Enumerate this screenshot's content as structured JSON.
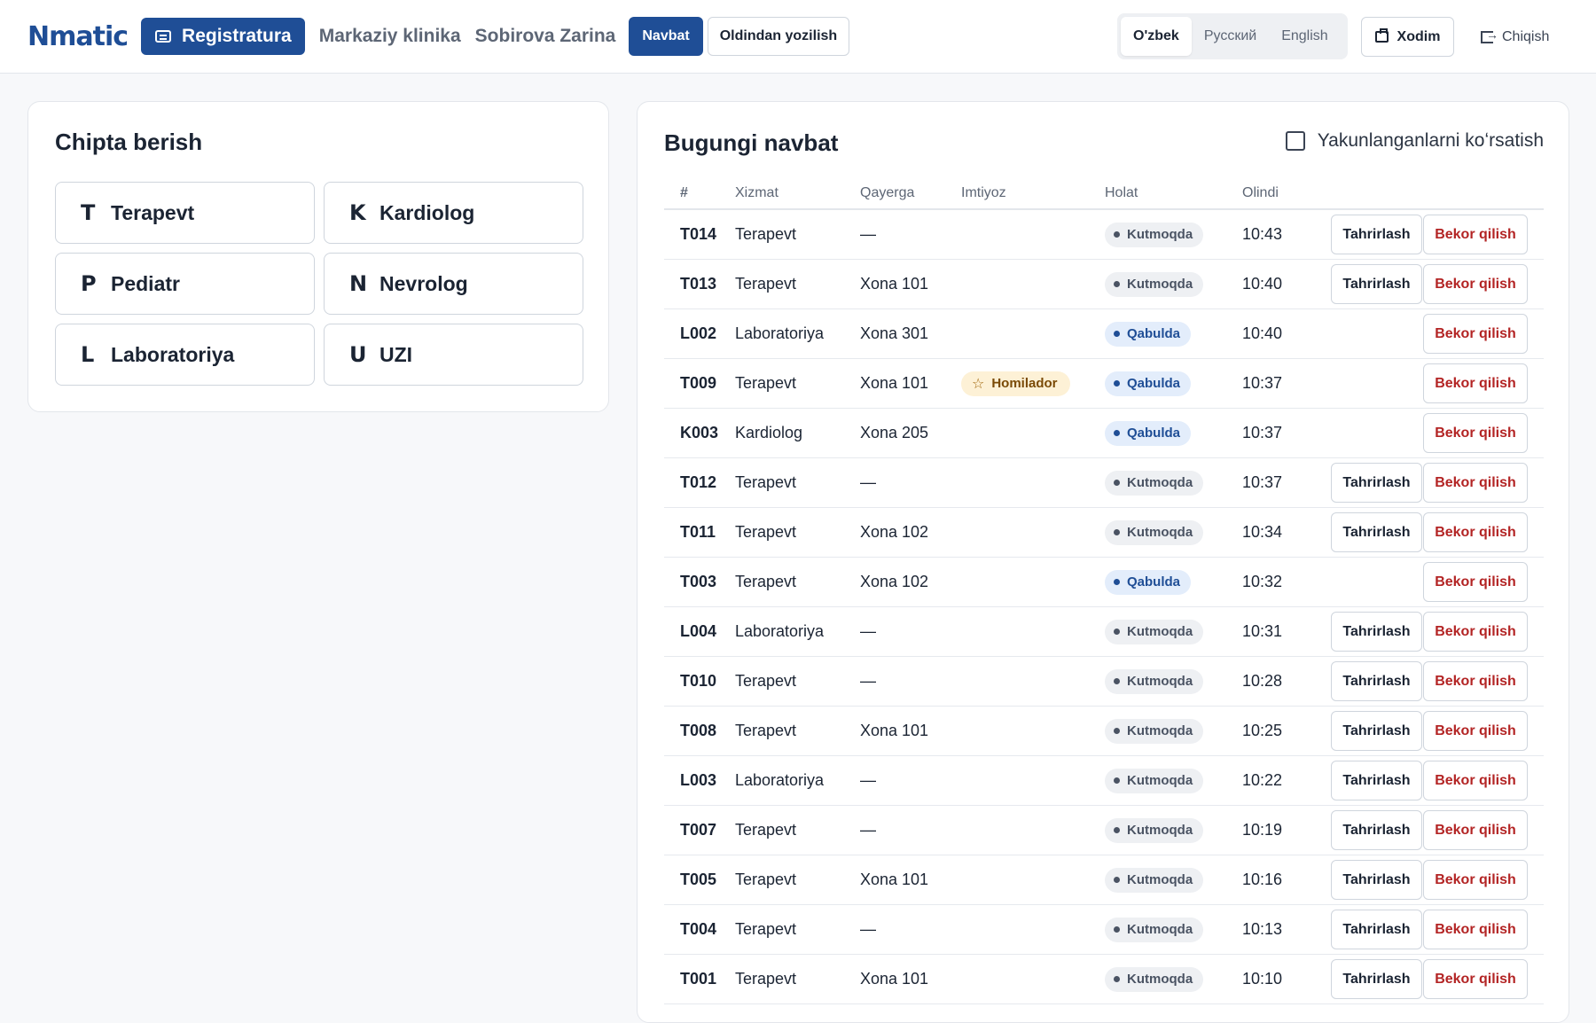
{
  "header": {
    "logo": "Nmatic",
    "registratura_label": "Registratura",
    "clinic_name": "Markaziy klinika",
    "user_name": "Sobirova Zarina",
    "navbat_label": "Navbat",
    "prebook_label": "Oldindan yozilish",
    "languages": [
      "O'zbek",
      "Русский",
      "English"
    ],
    "active_language": "O'zbek",
    "staff_label": "Xodim",
    "logout_label": "Chiqish"
  },
  "ticket_panel": {
    "title": "Chipta berish",
    "services": [
      {
        "letter": "T",
        "label": "Terapevt"
      },
      {
        "letter": "K",
        "label": "Kardiolog"
      },
      {
        "letter": "P",
        "label": "Pediatr"
      },
      {
        "letter": "N",
        "label": "Nevrolog"
      },
      {
        "letter": "L",
        "label": "Laboratoriya"
      },
      {
        "letter": "U",
        "label": "UZI"
      }
    ]
  },
  "queue": {
    "title": "Bugungi navbat",
    "show_completed_label": "Yakunlanganlarni koʻrsatish",
    "show_completed_checked": false,
    "columns": [
      "#",
      "Xizmat",
      "Qayerga",
      "Imtiyoz",
      "Holat",
      "Olindi"
    ],
    "edit_label": "Tahrirlash",
    "cancel_label": "Bekor qilish",
    "rows": [
      {
        "id": "T014",
        "service": "Terapevt",
        "room": "—",
        "privilege": "",
        "status": "Kutmoqda",
        "status_type": "wait",
        "time": "10:43",
        "editable": true
      },
      {
        "id": "T013",
        "service": "Terapevt",
        "room": "Xona 101",
        "privilege": "",
        "status": "Kutmoqda",
        "status_type": "wait",
        "time": "10:40",
        "editable": true
      },
      {
        "id": "L002",
        "service": "Laboratoriya",
        "room": "Xona 301",
        "privilege": "",
        "status": "Qabulda",
        "status_type": "inroom",
        "time": "10:40",
        "editable": false
      },
      {
        "id": "T009",
        "service": "Terapevt",
        "room": "Xona 101",
        "privilege": "Homilador",
        "status": "Qabulda",
        "status_type": "inroom",
        "time": "10:37",
        "editable": false
      },
      {
        "id": "K003",
        "service": "Kardiolog",
        "room": "Xona 205",
        "privilege": "",
        "status": "Qabulda",
        "status_type": "inroom",
        "time": "10:37",
        "editable": false
      },
      {
        "id": "T012",
        "service": "Terapevt",
        "room": "—",
        "privilege": "",
        "status": "Kutmoqda",
        "status_type": "wait",
        "time": "10:37",
        "editable": true
      },
      {
        "id": "T011",
        "service": "Terapevt",
        "room": "Xona 102",
        "privilege": "",
        "status": "Kutmoqda",
        "status_type": "wait",
        "time": "10:34",
        "editable": true
      },
      {
        "id": "T003",
        "service": "Terapevt",
        "room": "Xona 102",
        "privilege": "",
        "status": "Qabulda",
        "status_type": "inroom",
        "time": "10:32",
        "editable": false
      },
      {
        "id": "L004",
        "service": "Laboratoriya",
        "room": "—",
        "privilege": "",
        "status": "Kutmoqda",
        "status_type": "wait",
        "time": "10:31",
        "editable": true
      },
      {
        "id": "T010",
        "service": "Terapevt",
        "room": "—",
        "privilege": "",
        "status": "Kutmoqda",
        "status_type": "wait",
        "time": "10:28",
        "editable": true
      },
      {
        "id": "T008",
        "service": "Terapevt",
        "room": "Xona 101",
        "privilege": "",
        "status": "Kutmoqda",
        "status_type": "wait",
        "time": "10:25",
        "editable": true
      },
      {
        "id": "L003",
        "service": "Laboratoriya",
        "room": "—",
        "privilege": "",
        "status": "Kutmoqda",
        "status_type": "wait",
        "time": "10:22",
        "editable": true
      },
      {
        "id": "T007",
        "service": "Terapevt",
        "room": "—",
        "privilege": "",
        "status": "Kutmoqda",
        "status_type": "wait",
        "time": "10:19",
        "editable": true
      },
      {
        "id": "T005",
        "service": "Terapevt",
        "room": "Xona 101",
        "privilege": "",
        "status": "Kutmoqda",
        "status_type": "wait",
        "time": "10:16",
        "editable": true
      },
      {
        "id": "T004",
        "service": "Terapevt",
        "room": "—",
        "privilege": "",
        "status": "Kutmoqda",
        "status_type": "wait",
        "time": "10:13",
        "editable": true
      },
      {
        "id": "T001",
        "service": "Terapevt",
        "room": "Xona 101",
        "privilege": "",
        "status": "Kutmoqda",
        "status_type": "wait",
        "time": "10:10",
        "editable": true
      }
    ]
  },
  "colors": {
    "primary": "#1f4e96",
    "danger": "#b32424",
    "privilege_bg": "#fdf1d6"
  }
}
